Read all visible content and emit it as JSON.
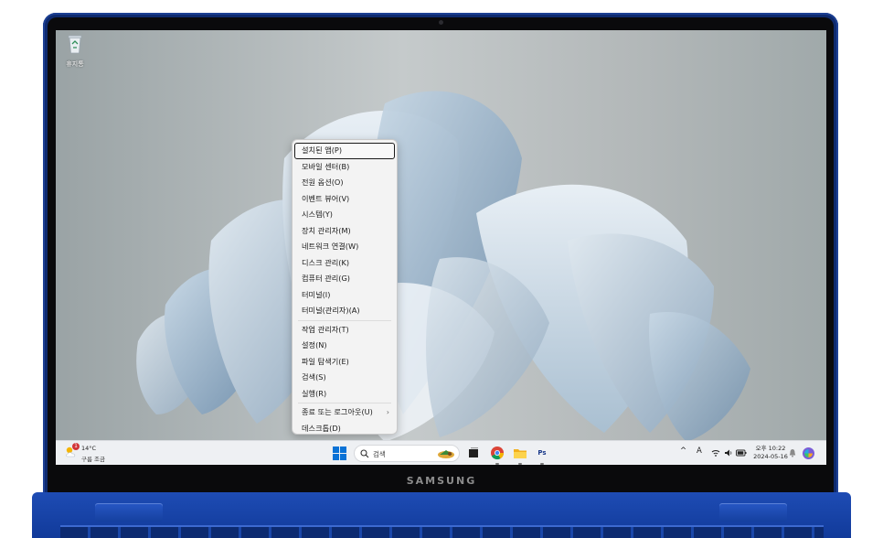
{
  "device": {
    "brand": "SAMSUNG"
  },
  "desktop": {
    "icons": [
      {
        "label": "휴지통",
        "icon": "recycle-bin-icon"
      }
    ]
  },
  "context_menu": {
    "items": [
      {
        "label": "설치된 앱(P)",
        "selected": true
      },
      {
        "label": "모바일 센터(B)"
      },
      {
        "label": "전원 옵션(O)"
      },
      {
        "label": "이벤트 뷰어(V)"
      },
      {
        "label": "시스템(Y)"
      },
      {
        "label": "장치 관리자(M)"
      },
      {
        "label": "네트워크 연결(W)"
      },
      {
        "label": "디스크 관리(K)"
      },
      {
        "label": "컴퓨터 관리(G)"
      },
      {
        "label": "터미널(I)"
      },
      {
        "label": "터미널(관리자)(A)"
      },
      {
        "label": "작업 관리자(T)"
      },
      {
        "label": "설정(N)"
      },
      {
        "label": "파일 탐색기(E)"
      },
      {
        "label": "검색(S)"
      },
      {
        "label": "실행(R)"
      },
      {
        "label": "종료 또는 로그아웃(U)",
        "submenu_arrow": "›"
      },
      {
        "label": "데스크톱(D)"
      }
    ]
  },
  "taskbar": {
    "weather": {
      "temperature": "14°C",
      "description": "구름 조금",
      "badge": "1"
    },
    "search": {
      "label": "검색"
    },
    "pinned_apps": [
      {
        "name": "task-view",
        "icon": "task-view-icon"
      },
      {
        "name": "chrome",
        "icon": "chrome-icon"
      },
      {
        "name": "file-explorer",
        "icon": "folder-icon"
      },
      {
        "name": "photoshop",
        "icon": "photoshop-icon",
        "text": "Ps"
      }
    ],
    "tray": {
      "chevron": "^",
      "language": "A",
      "clock": {
        "ampm_time": "오후 10:22",
        "date": "2024-05-16"
      }
    }
  },
  "colors": {
    "accent_blue": "#0067c0",
    "laptop_blue": "#0e2a6e",
    "badge_red": "#d13438"
  }
}
